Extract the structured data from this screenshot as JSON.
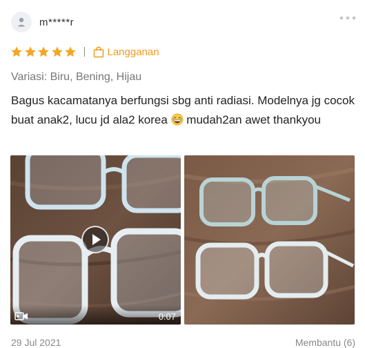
{
  "review": {
    "username": "m*****r",
    "stars": 5,
    "badge_label": "Langganan",
    "variant": "Variasi: Biru, Bening, Hijau",
    "comment_part1": "Bagus kacamatanya berfungsi sbg anti radiasi. Modelnya jg cocok buat anak2, lucu jd ala2 korea",
    "comment_part2": " mudah2an awet thankyou",
    "video_duration": "0:07",
    "date": "29 Jul 2021",
    "helpful": "Membantu (6)"
  },
  "icons": {
    "avatar": "user-icon",
    "more": "more-horizontal-icon",
    "star": "star-icon",
    "badge": "shopping-bag-icon",
    "play": "play-icon",
    "video": "video-camera-icon",
    "emoji": "laughing-emoji-icon"
  },
  "colors": {
    "star": "#f5a623",
    "badge": "#ee9b1a",
    "muted": "#888888"
  }
}
